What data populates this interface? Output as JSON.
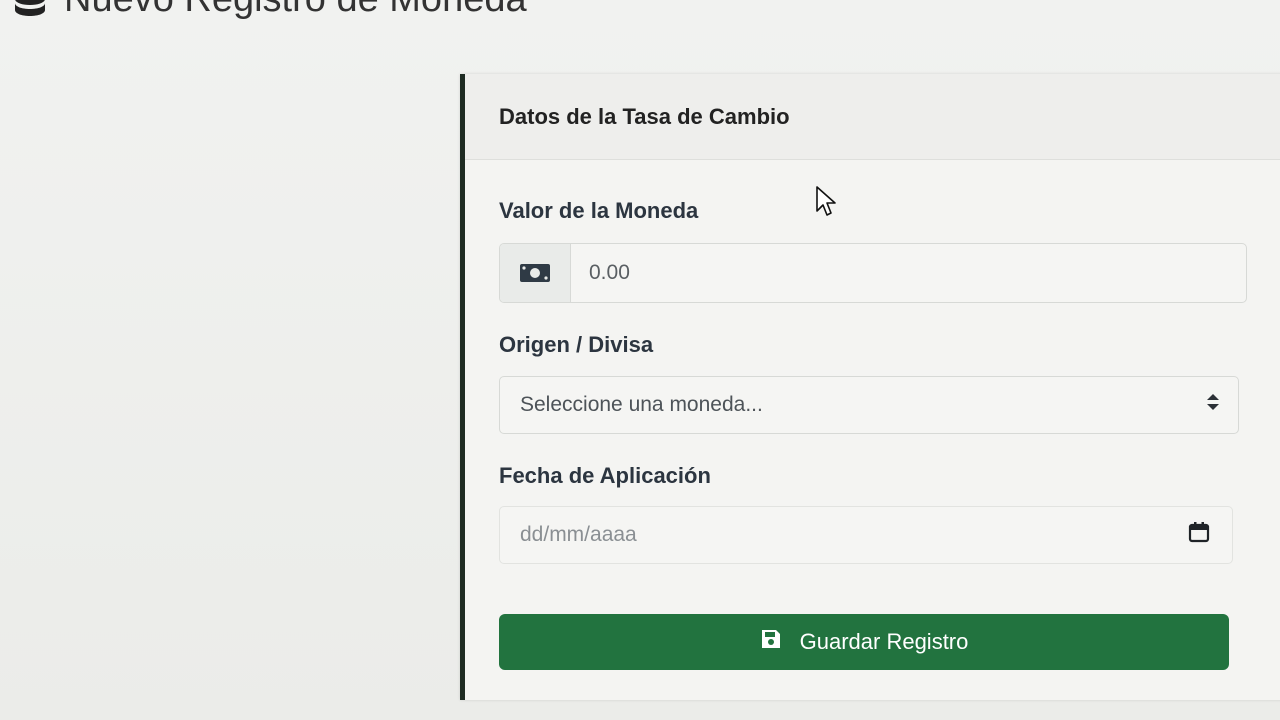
{
  "page": {
    "title": "Nuevo Registro de Moneda",
    "title_icon": "database-icon"
  },
  "card": {
    "header": "Datos de la Tasa de Cambio",
    "accent_color": "#22733f"
  },
  "form": {
    "value": {
      "label": "Valor de la Moneda",
      "icon": "money-bill-icon",
      "placeholder": "0.00"
    },
    "currency": {
      "label": "Origen / Divisa",
      "selected": "Seleccione una moneda..."
    },
    "date": {
      "label": "Fecha de Aplicación",
      "placeholder": "dd/mm/aaaa",
      "icon": "calendar-icon"
    },
    "submit": {
      "label": "Guardar Registro",
      "icon": "save-icon"
    }
  }
}
